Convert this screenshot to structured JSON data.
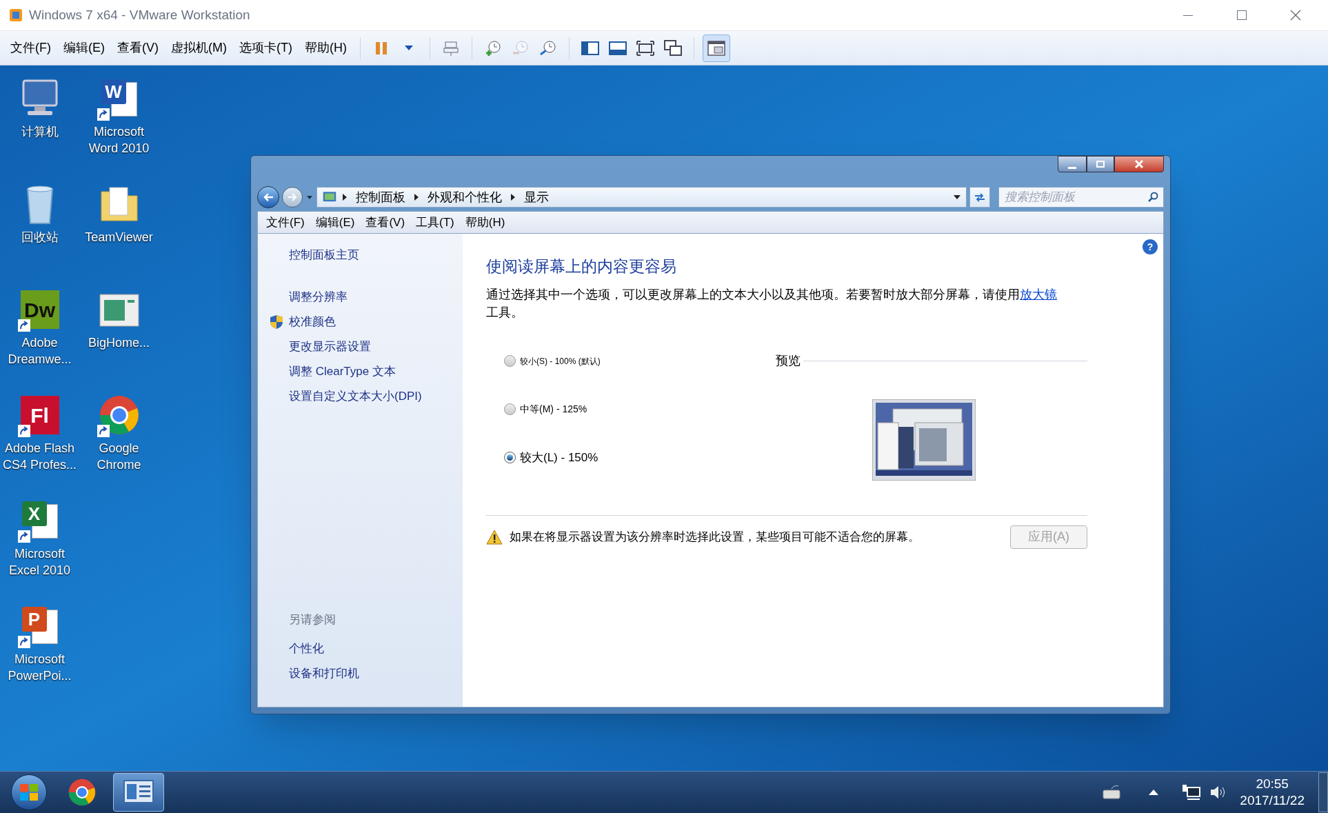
{
  "vm_window": {
    "title": "Windows 7 x64 - VMware Workstation",
    "menu": [
      "文件(F)",
      "编辑(E)",
      "查看(V)",
      "虚拟机(M)",
      "选项卡(T)",
      "帮助(H)"
    ]
  },
  "desktop_icons": [
    {
      "label": "计算机",
      "kind": "computer",
      "shortcut": false
    },
    {
      "label": "回收站",
      "kind": "recycle",
      "shortcut": false
    },
    {
      "label": "Adobe Dreamwe...",
      "kind": "dw",
      "logo": "Dw",
      "shortcut": true
    },
    {
      "label": "Adobe Flash CS4 Profes...",
      "kind": "flash",
      "logo": "Fl",
      "shortcut": true
    },
    {
      "label": "Microsoft Excel 2010",
      "kind": "excel",
      "logo": "X",
      "shortcut": true
    },
    {
      "label": "Microsoft PowerPoi...",
      "kind": "powerpoint",
      "logo": "P",
      "shortcut": true
    },
    {
      "label": "Microsoft Word 2010",
      "kind": "word",
      "logo": "W",
      "shortcut": true
    },
    {
      "label": "TeamViewer",
      "kind": "folder",
      "shortcut": false
    },
    {
      "label": "BigHome...",
      "kind": "bighome",
      "shortcut": false
    },
    {
      "label": "Google Chrome",
      "kind": "chrome",
      "shortcut": true
    }
  ],
  "explorer": {
    "breadcrumb": [
      "控制面板",
      "外观和个性化",
      "显示"
    ],
    "search": {
      "placeholder": "搜索控制面板"
    },
    "menu": [
      "文件(F)",
      "编辑(E)",
      "查看(V)",
      "工具(T)",
      "帮助(H)"
    ],
    "help_icon": "?",
    "sidebar": {
      "home": "控制面板主页",
      "tasks": [
        {
          "label": "调整分辨率",
          "kind": "link"
        },
        {
          "label": "校准颜色",
          "kind": "shield"
        },
        {
          "label": "更改显示器设置",
          "kind": "link"
        },
        {
          "label": "调整 ClearType 文本",
          "kind": "link"
        },
        {
          "label": "设置自定义文本大小(DPI)",
          "kind": "link"
        }
      ],
      "see_also": "另请参阅",
      "links": [
        "个性化",
        "设备和打印机"
      ]
    },
    "heading": "使阅读屏幕上的内容更容易",
    "description": "通过选择其中一个选项，可以更改屏幕上的文本大小以及其他项。若要暂时放大部分屏幕，请使用",
    "description_link": "放大镜",
    "description_end": "工具。",
    "options": [
      {
        "label": "较小(S) - 100% (默认)",
        "selected": false
      },
      {
        "label": "中等(M) - 125%",
        "selected": false
      },
      {
        "label": "较大(L) - 150%",
        "selected": true
      }
    ],
    "preview_label": "预览",
    "warning": "如果在将显示器设置为该分辨率时选择此设置，某些项目可能不适合您的屏幕。",
    "apply_button": {
      "label": "应用(A)",
      "disabled": true
    }
  },
  "taskbar": {
    "items": [
      {
        "kind": "chrome",
        "active": false
      },
      {
        "kind": "control-panel",
        "active": true
      }
    ],
    "time": "20:55",
    "date": "2017/11/22"
  }
}
